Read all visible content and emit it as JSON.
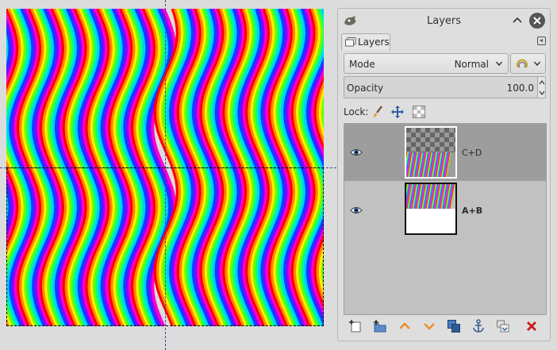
{
  "dock": {
    "title": "Layers",
    "tab_label": "Layers"
  },
  "mode": {
    "label": "Mode",
    "value": "Normal"
  },
  "opacity": {
    "label": "Opacity",
    "value": "100.0"
  },
  "lock": {
    "label": "Lock:"
  },
  "layers": [
    {
      "name": "C+D",
      "visible": true,
      "selected": true
    },
    {
      "name": "A+B",
      "visible": true,
      "selected": false
    }
  ],
  "colors": {
    "selected_row": "#9d9d9d",
    "list_bg": "#c1c1c1",
    "delete": "#cc1b1b",
    "raise_lower": "#e8912a"
  },
  "icons": [
    "gimp-icon",
    "collapse-icon",
    "close-icon",
    "layers-tab-icon",
    "tab-menu-icon",
    "chevron-down-icon",
    "paint-brush-icon",
    "move-icon",
    "alpha-lock-icon",
    "eye-icon",
    "new-layer-icon",
    "new-layer-group-icon",
    "raise-layer-icon",
    "lower-layer-icon",
    "duplicate-layer-icon",
    "anchor-icon",
    "merge-down-icon",
    "delete-layer-icon"
  ]
}
